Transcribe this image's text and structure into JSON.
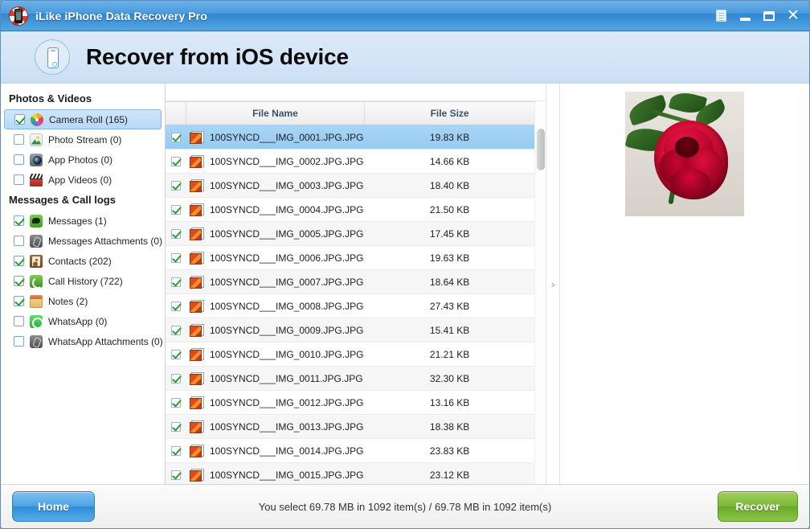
{
  "window": {
    "title": "iLike iPhone Data Recovery Pro",
    "app_icon": "lifebuoy-phone-icon",
    "controls": {
      "menu": "menu-document-icon",
      "minimize": "minimize-icon",
      "maximize": "maximize-icon",
      "close": "✕"
    }
  },
  "header": {
    "icon": "iphone-outline-icon",
    "title": "Recover from iOS device"
  },
  "sidebar": {
    "groups": [
      {
        "title": "Photos & Videos",
        "items": [
          {
            "label": "Camera Roll (165)",
            "checked": true,
            "selected": true,
            "icon": "camera-roll-icon"
          },
          {
            "label": "Photo Stream (0)",
            "checked": false,
            "selected": false,
            "icon": "photo-stream-icon"
          },
          {
            "label": "App Photos (0)",
            "checked": false,
            "selected": false,
            "icon": "app-photos-icon"
          },
          {
            "label": "App Videos (0)",
            "checked": false,
            "selected": false,
            "icon": "app-videos-icon"
          }
        ]
      },
      {
        "title": "Messages & Call logs",
        "items": [
          {
            "label": "Messages (1)",
            "checked": true,
            "selected": false,
            "icon": "messages-icon"
          },
          {
            "label": "Messages Attachments (0)",
            "checked": false,
            "selected": false,
            "icon": "attachment-icon"
          },
          {
            "label": "Contacts (202)",
            "checked": true,
            "selected": false,
            "icon": "contacts-icon"
          },
          {
            "label": "Call History (722)",
            "checked": true,
            "selected": false,
            "icon": "call-history-icon"
          },
          {
            "label": "Notes (2)",
            "checked": true,
            "selected": false,
            "icon": "notes-icon"
          },
          {
            "label": "WhatsApp (0)",
            "checked": false,
            "selected": false,
            "icon": "whatsapp-icon"
          },
          {
            "label": "WhatsApp Attachments (0)",
            "checked": false,
            "selected": false,
            "icon": "attachment-icon"
          }
        ]
      }
    ]
  },
  "file_list": {
    "columns": {
      "name": "File Name",
      "size": "File Size"
    },
    "rows": [
      {
        "name": "100SYNCD___IMG_0001.JPG.JPG",
        "size": "19.83 KB",
        "checked": true,
        "selected": true
      },
      {
        "name": "100SYNCD___IMG_0002.JPG.JPG",
        "size": "14.66 KB",
        "checked": true,
        "selected": false
      },
      {
        "name": "100SYNCD___IMG_0003.JPG.JPG",
        "size": "18.40 KB",
        "checked": true,
        "selected": false
      },
      {
        "name": "100SYNCD___IMG_0004.JPG.JPG",
        "size": "21.50 KB",
        "checked": true,
        "selected": false
      },
      {
        "name": "100SYNCD___IMG_0005.JPG.JPG",
        "size": "17.45 KB",
        "checked": true,
        "selected": false
      },
      {
        "name": "100SYNCD___IMG_0006.JPG.JPG",
        "size": "19.63 KB",
        "checked": true,
        "selected": false
      },
      {
        "name": "100SYNCD___IMG_0007.JPG.JPG",
        "size": "18.64 KB",
        "checked": true,
        "selected": false
      },
      {
        "name": "100SYNCD___IMG_0008.JPG.JPG",
        "size": "27.43 KB",
        "checked": true,
        "selected": false
      },
      {
        "name": "100SYNCD___IMG_0009.JPG.JPG",
        "size": "15.41 KB",
        "checked": true,
        "selected": false
      },
      {
        "name": "100SYNCD___IMG_0010.JPG.JPG",
        "size": "21.21 KB",
        "checked": true,
        "selected": false
      },
      {
        "name": "100SYNCD___IMG_0011.JPG.JPG",
        "size": "32.30 KB",
        "checked": true,
        "selected": false
      },
      {
        "name": "100SYNCD___IMG_0012.JPG.JPG",
        "size": "13.16 KB",
        "checked": true,
        "selected": false
      },
      {
        "name": "100SYNCD___IMG_0013.JPG.JPG",
        "size": "18.38 KB",
        "checked": true,
        "selected": false
      },
      {
        "name": "100SYNCD___IMG_0014.JPG.JPG",
        "size": "23.83 KB",
        "checked": true,
        "selected": false
      },
      {
        "name": "100SYNCD___IMG_0015.JPG.JPG",
        "size": "23.12 KB",
        "checked": true,
        "selected": false
      }
    ]
  },
  "preview": {
    "image_alt": "red-rose-photo"
  },
  "collapse_toggle": "›",
  "footer": {
    "home_label": "Home",
    "recover_label": "Recover",
    "status": "You select 69.78 MB in 1092 item(s) / 69.78 MB in 1092 item(s)"
  },
  "colors": {
    "titlebar_blue": "#2f86d2",
    "header_blue": "#d4e5f6",
    "selection_blue": "#95cbf2",
    "recover_green": "#7cb73c",
    "home_blue": "#4ea3e4",
    "check_green": "#2f9b2f"
  }
}
